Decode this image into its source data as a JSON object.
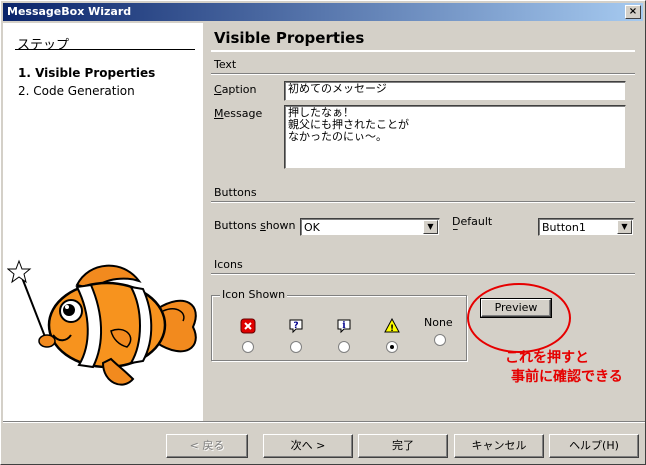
{
  "window": {
    "title": "MessageBox Wizard",
    "close_glyph": "×"
  },
  "left_pane": {
    "heading": "ステップ",
    "steps": [
      {
        "label": "1. Visible Properties",
        "active": true
      },
      {
        "label": "2. Code Generation",
        "active": false
      }
    ],
    "mascot_icon": "clownfish-wizard-mascot"
  },
  "page": {
    "title": "Visible Properties",
    "text_section": "Text",
    "caption_label_accel": "C",
    "caption_label_rest": "aption",
    "caption_value": "初めてのメッセージ",
    "message_label_accel": "M",
    "message_label_rest": "essage",
    "message_value": "押したなぁ！\n親父にも押されたことが\nなかったのにぃ〜。",
    "buttons_section": "Buttons",
    "buttons_shown_label_pre": "Buttons ",
    "buttons_shown_label_accel": "s",
    "buttons_shown_label_post": "hown",
    "buttons_shown_value": "OK",
    "default_button_label": "Default B...",
    "default_button_value": "Button1",
    "icons_section": "Icons",
    "icon_shown_legend": "Icon Shown",
    "icons": [
      {
        "name": "error-icon",
        "checked": false
      },
      {
        "name": "question-icon",
        "checked": false
      },
      {
        "name": "info-icon",
        "checked": false
      },
      {
        "name": "warning-icon",
        "checked": true
      },
      {
        "name": "none",
        "label": "None",
        "checked": false
      }
    ],
    "preview_label": "Preview"
  },
  "annotation": {
    "line1": "これを押すと",
    "line2": "事前に確認できる",
    "color": "#e60000"
  },
  "footer": {
    "back_label": "< 戻る",
    "next_label": "次へ >",
    "finish_label": "完了",
    "cancel_label": "キャンセル",
    "help_label": "ヘルプ(H)"
  },
  "colors": {
    "titlebar_start": "#0a246a",
    "titlebar_end": "#a6caf0",
    "face": "#d4d0c8"
  }
}
